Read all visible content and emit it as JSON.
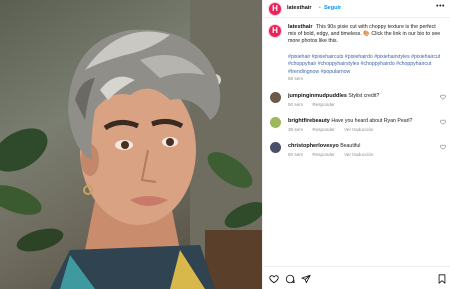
{
  "post": {
    "author": "latesthair",
    "follow_label": "Seguir",
    "separator": "•",
    "more_label": "•••",
    "avatar_letter": "H",
    "caption": "This 90s pixie cut with choppy texture is the perfect mix of bold, edgy, and timeless. 🎨 Click the link in our bio to see more photos like this.",
    "hashtags": "#pixiehair #pixiehaircuts #pixiehairdo #pixiehairstyles #pixiehaircut #choppyhair #choppyhairstyles #choppyhairdo #choppyhaircut #trendingnow #popularnow",
    "time": "58 sem"
  },
  "comments": [
    {
      "user": "jumpinginmudpuddles",
      "text": "Stylist credit?",
      "time": "50 sem",
      "reply": "Responder",
      "translate": "",
      "avatar_color": "#6b5a4a"
    },
    {
      "user": "brightfirebeauty",
      "text": "Have you heard about Ryan Pearl?",
      "time": "39 sem",
      "reply": "Responder",
      "translate": "Ver traducción",
      "avatar_color": "#9bb85c"
    },
    {
      "user": "christopherlovesyo",
      "text": "Beautiful",
      "time": "50 sem",
      "reply": "Responder",
      "translate": "Ver traducción",
      "avatar_color": "#4a4e6a"
    }
  ],
  "icons": {
    "like": "heart-icon",
    "comment": "comment-icon",
    "share": "share-icon",
    "save": "bookmark-icon"
  },
  "colors": {
    "brand": "#e8245a",
    "link": "#0095f6",
    "hashtag": "#3f64a8"
  }
}
